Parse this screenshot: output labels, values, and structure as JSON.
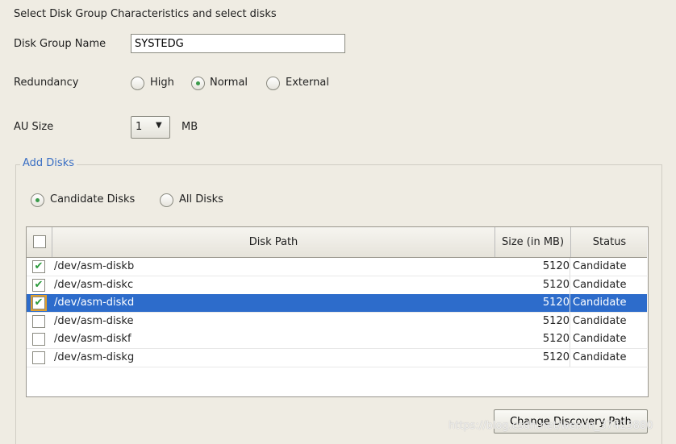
{
  "heading": "Select Disk Group Characteristics and select disks",
  "disk_group_name": {
    "label": "Disk Group Name",
    "value": "SYSTEDG"
  },
  "redundancy": {
    "label": "Redundancy",
    "options": [
      "High",
      "Normal",
      "External"
    ],
    "selected": "Normal"
  },
  "au_size": {
    "label": "AU Size",
    "value": "1",
    "unit": "MB"
  },
  "add_disks": {
    "legend": "Add Disks",
    "filters": [
      "Candidate Disks",
      "All Disks"
    ],
    "selected_filter": "Candidate Disks"
  },
  "table": {
    "headers": [
      "Disk Path",
      "Size (in MB)",
      "Status"
    ],
    "rows": [
      {
        "checked": true,
        "path": "/dev/asm-diskb",
        "size": "5120",
        "status": "Candidate"
      },
      {
        "checked": true,
        "path": "/dev/asm-diskc",
        "size": "5120",
        "status": "Candidate"
      },
      {
        "checked": true,
        "path": "/dev/asm-diskd",
        "size": "5120",
        "status": "Candidate",
        "selected": true
      },
      {
        "checked": false,
        "path": "/dev/asm-diske",
        "size": "5120",
        "status": "Candidate"
      },
      {
        "checked": false,
        "path": "/dev/asm-diskf",
        "size": "5120",
        "status": "Candidate"
      },
      {
        "checked": false,
        "path": "/dev/asm-diskg",
        "size": "5120",
        "status": "Candidate"
      }
    ]
  },
  "change_discovery_path": "Change Discovery Path",
  "watermark": "https://blog.csdn.net/weixin_37423880",
  "colors": {
    "selection": "#2d6ccb",
    "legend": "#3a6fc4",
    "check": "#2a9a3a"
  }
}
